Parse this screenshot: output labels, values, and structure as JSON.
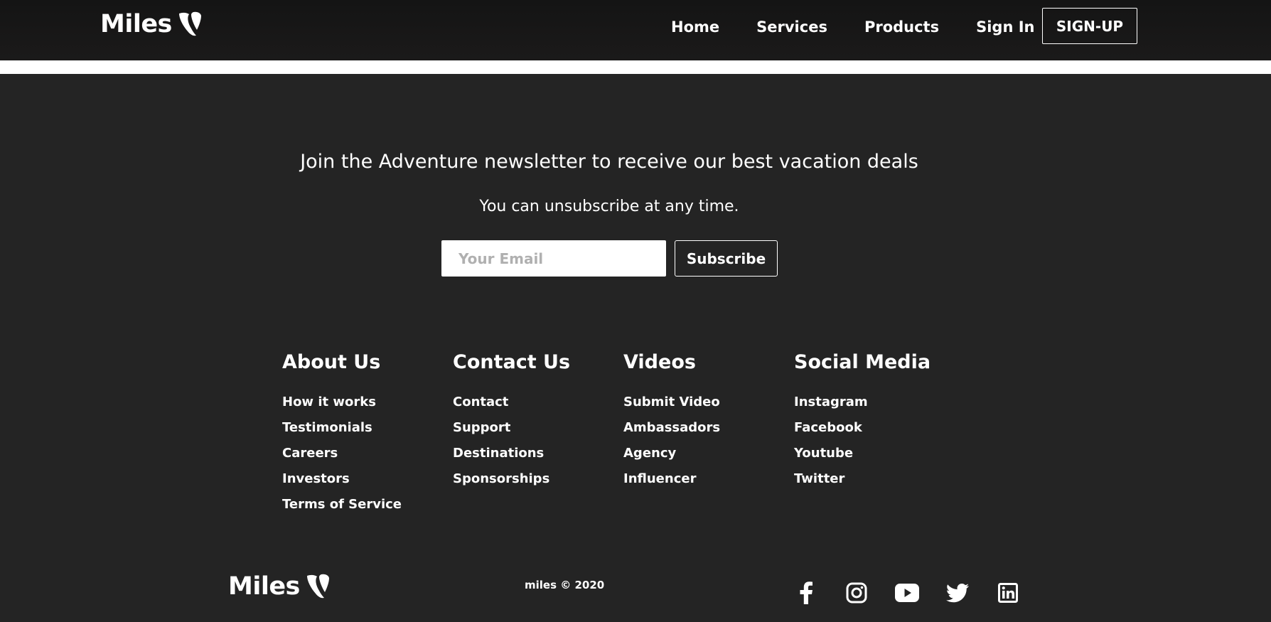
{
  "brand": {
    "name": "Miles"
  },
  "nav": {
    "links": [
      "Home",
      "Services",
      "Products",
      "Sign In"
    ],
    "signup_label": "SIGN-UP"
  },
  "newsletter": {
    "heading": "Join the Adventure newsletter to receive our best vacation deals",
    "subtext": "You can unsubscribe at any time.",
    "email_placeholder": "Your Email",
    "email_value": "",
    "subscribe_label": "Subscribe"
  },
  "footer": {
    "columns": [
      {
        "title": "About Us",
        "links": [
          "How it works",
          "Testimonials",
          "Careers",
          "Investors",
          "Terms of Service"
        ]
      },
      {
        "title": "Contact Us",
        "links": [
          "Contact",
          "Support",
          "Destinations",
          "Sponsorships"
        ]
      },
      {
        "title": "Videos",
        "links": [
          "Submit Video",
          "Ambassadors",
          "Agency",
          "Influencer"
        ]
      },
      {
        "title": "Social Media",
        "links": [
          "Instagram",
          "Facebook",
          "Youtube",
          "Twitter"
        ]
      }
    ],
    "copyright": "miles © 2020",
    "social_icons": [
      "facebook-icon",
      "instagram-icon",
      "youtube-icon",
      "twitter-icon",
      "linkedin-icon"
    ]
  },
  "colors": {
    "background": "#242424",
    "navbar": "#1a1919",
    "text": "#ffffff",
    "placeholder": "#b0b0b0"
  }
}
